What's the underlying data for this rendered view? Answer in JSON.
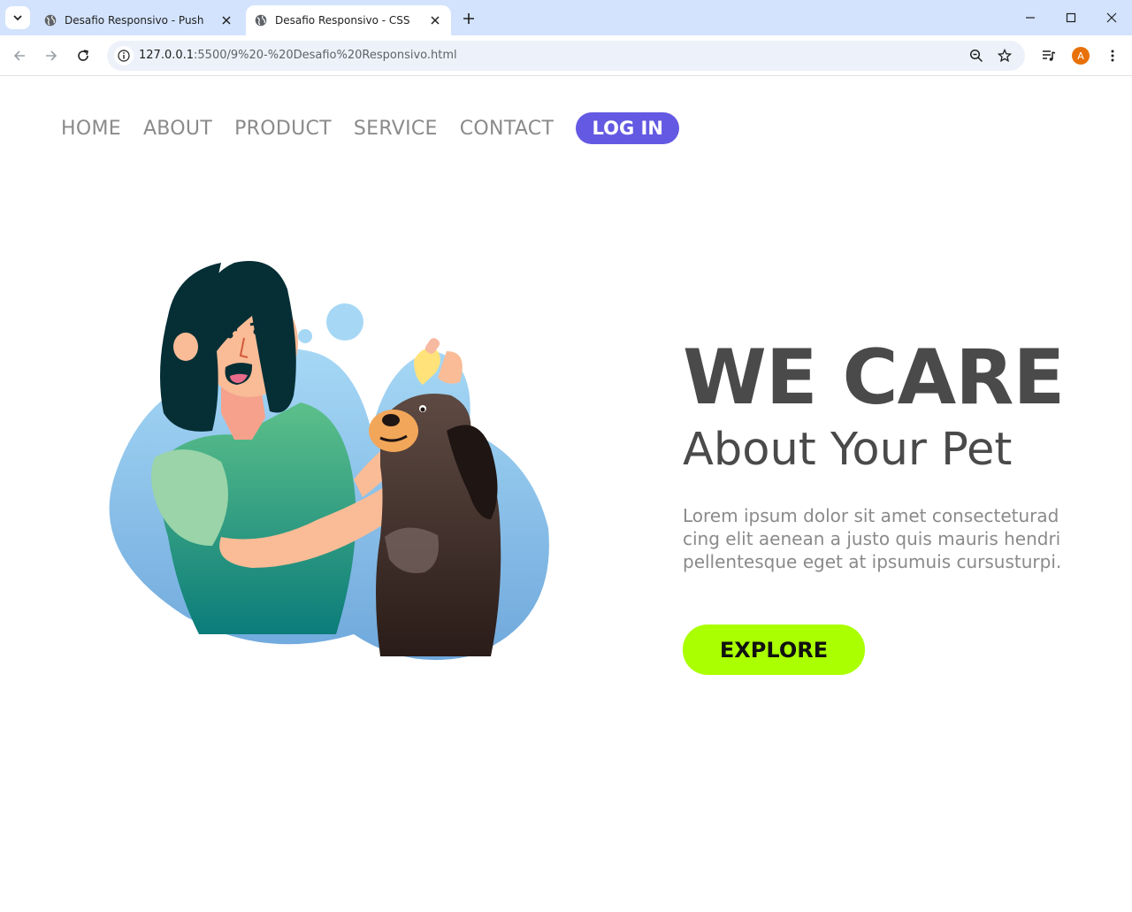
{
  "browser": {
    "tabs": [
      {
        "title": "Desafio Responsivo - Push",
        "active": false
      },
      {
        "title": "Desafio Responsivo - CSS",
        "active": true
      }
    ],
    "url_host": "127.0.0.1",
    "url_rest": ":5500/9%20-%20Desafio%20Responsivo.html",
    "profile_initial": "A",
    "profile_color": "#e8710a"
  },
  "nav": {
    "links": [
      "HOME",
      "ABOUT",
      "PRODUCT",
      "SERVICE",
      "CONTACT"
    ],
    "login_label": "LOG IN",
    "login_color": "#6459e2"
  },
  "hero": {
    "title": "WE CARE",
    "subtitle": "About Your Pet",
    "paragraph_lines": [
      "Lorem ipsum dolor sit amet consecteturad",
      "cing elit aenean a justo quis mauris hendri",
      "pellentesque eget at ipsumuis cursusturpi."
    ],
    "explore_label": "EXPLORE",
    "explore_color": "#aaff00"
  },
  "colors": {
    "text_dark": "#4a4a4a",
    "text_muted": "#8a8a8a",
    "chrome_bg": "#d3e3fd"
  }
}
